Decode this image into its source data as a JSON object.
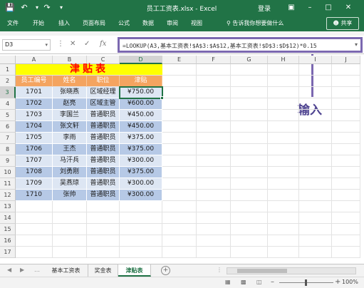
{
  "titlebar": {
    "save_icon": "save-icon",
    "undo_icon": "undo-icon",
    "redo_icon": "redo-icon",
    "title": "员工工资表.xlsx - Excel",
    "login": "登录"
  },
  "ribbon": {
    "tabs": [
      "文件",
      "开始",
      "插入",
      "页面布局",
      "公式",
      "数据",
      "审阅",
      "视图"
    ],
    "tell_me": "告诉我你想要做什么",
    "share": "共享"
  },
  "formula_bar": {
    "name_box": "D3",
    "formula": "=LOOKUP(A3,基本工资表!$A$3:$A$12,基本工资表!$D$3:$D$12)*0.15"
  },
  "annotation": "输入",
  "columns": [
    "A",
    "B",
    "C",
    "D",
    "E",
    "F",
    "G",
    "H",
    "I",
    "J"
  ],
  "rows": [
    "1",
    "2",
    "3",
    "4",
    "5",
    "6",
    "7",
    "8",
    "9",
    "10",
    "11",
    "12",
    "13",
    "14",
    "15",
    "16",
    "17"
  ],
  "table": {
    "title": "津贴表",
    "headers": [
      "员工编号",
      "姓名",
      "职位",
      "津贴"
    ],
    "data": [
      [
        "1701",
        "张晓燕",
        "区域经理",
        "¥750.00"
      ],
      [
        "1702",
        "赵亮",
        "区域主管",
        "¥600.00"
      ],
      [
        "1703",
        "李国兰",
        "普通职员",
        "¥450.00"
      ],
      [
        "1704",
        "张文轩",
        "普通职员",
        "¥450.00"
      ],
      [
        "1705",
        "李雨",
        "普通职员",
        "¥375.00"
      ],
      [
        "1706",
        "王杰",
        "普通职员",
        "¥375.00"
      ],
      [
        "1707",
        "马汗兵",
        "普通职员",
        "¥300.00"
      ],
      [
        "1708",
        "刘勇刚",
        "普通职员",
        "¥375.00"
      ],
      [
        "1709",
        "吴燕琼",
        "普通职员",
        "¥300.00"
      ],
      [
        "1710",
        "张帅",
        "普通职员",
        "¥300.00"
      ]
    ]
  },
  "sheets": [
    "基本工资表",
    "奖金表",
    "津贴表"
  ],
  "active_sheet": "津贴表",
  "status": {
    "ready": "",
    "zoom": "100%"
  },
  "colors": {
    "excel_green": "#217346",
    "title_fill": "#ffff00",
    "title_text": "#ff0000",
    "header_fill": "#f4a460",
    "band_light": "#dde6f3",
    "band_dark": "#b6c9e6",
    "annotation": "#7b68b0"
  }
}
